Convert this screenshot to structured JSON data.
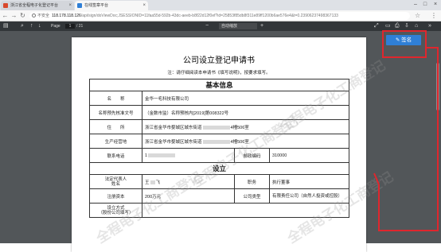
{
  "browser": {
    "tabs": [
      {
        "title": "浙江省全程电子化登记平台",
        "favicon_color": "#d9482b"
      },
      {
        "title": "在线签章平台",
        "favicon_color": "#2f7fd6"
      }
    ],
    "address": {
      "security_label": "不安全",
      "host": "118.178.118.126",
      "path": "/api/sign/doViewDoc;JSESSIONID=11faa55d-592b-43dc-aeeb-b8f22d12f0ef?id=25853f85db8f311e89ff1200b6ae576e4&t=0.23906237498367133"
    }
  },
  "pdf_toolbar": {
    "page_label": "Page",
    "page_current": "1",
    "page_total": "/ 21",
    "zoom": "自动缩放"
  },
  "document": {
    "title": "公司设立登记申请书",
    "note": "注：请仔细阅读本申请书《填写说明》，按要求填写。",
    "section_basic": "基本信息",
    "section_setup": "设立",
    "rows": {
      "name_label": "名　　称",
      "name_value": "金华一毛科技有限公司",
      "approval_label": "名称预先核准文号",
      "approval_value": "（金数市监）名称预核内[2019]第008322号",
      "address_label": "住　　所",
      "address_value_a": "浙江省金华市婺城区城东街道",
      "address_value_b": "4幢506室",
      "biz_label": "生产经营地",
      "biz_value_a": "浙江省金华市婺城区城东街道",
      "biz_value_b": "4幢506室",
      "phone_label": "联系电话",
      "phone_value": "1",
      "postcode_label": "邮政编码",
      "postcode_value": "310000",
      "rep_label_1": "法定代表人",
      "rep_label_2": "姓名",
      "rep_value": "王",
      "rep_value_end": "飞",
      "duty_label": "职务",
      "duty_value": "执行董事",
      "capital_label": "注册资本",
      "capital_value": "200万元",
      "type_label": "公司类型",
      "type_value": "有限责任公司（自然人投资或控股）",
      "method_label_1": "设立方式",
      "method_label_2": "（股份公司填写）"
    },
    "watermark_text": "全程电子化工商登记"
  },
  "sign_button": {
    "label": "签名",
    "icon": "pencil-icon"
  },
  "annotation_color": "#e0262d"
}
